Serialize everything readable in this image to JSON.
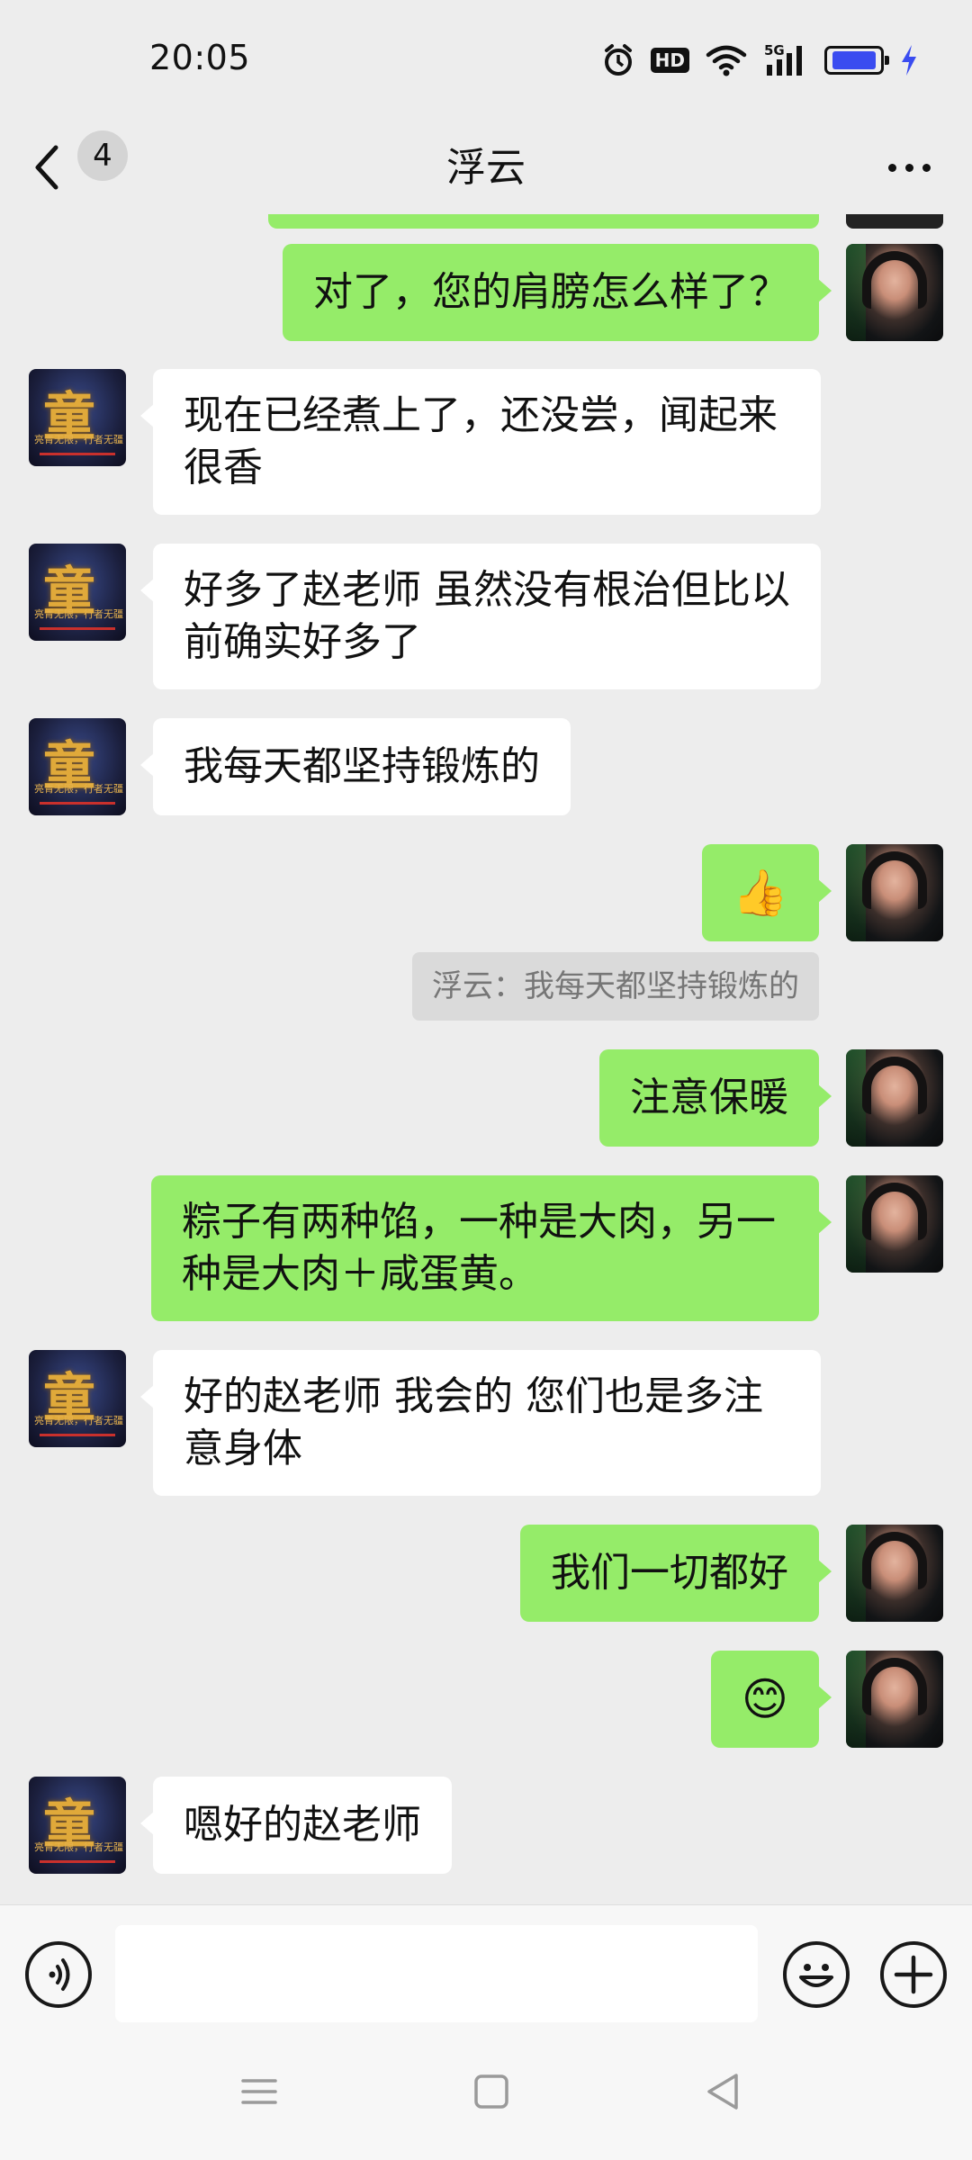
{
  "status_bar": {
    "time": "20:05",
    "icons": [
      "alarm-icon",
      "hd-icon",
      "wifi-icon",
      "5g-signal-icon",
      "battery-icon",
      "charging-icon"
    ],
    "hd_label": "HD",
    "network_label": "5G",
    "battery_level": 0.9,
    "battery_color": "#3a4cf0"
  },
  "nav": {
    "title": "浮云",
    "unread_count": "4"
  },
  "messages": [
    {
      "side": "out",
      "text": "对了，您的肩膀怎么样了？"
    },
    {
      "side": "in",
      "text": "现在已经煮上了，还没尝，闻起来很香"
    },
    {
      "side": "in",
      "text": "好多了赵老师  虽然没有根治但比以前确实好多了"
    },
    {
      "side": "in",
      "text": "我每天都坚持锻炼的"
    },
    {
      "side": "out",
      "text": "👍"
    },
    {
      "side": "quote",
      "text": "浮云：我每天都坚持锻炼的"
    },
    {
      "side": "out",
      "text": "注意保暖"
    },
    {
      "side": "out",
      "text": "粽子有两种馅，一种是大肉，另一种是大肉＋咸蛋黄。"
    },
    {
      "side": "in",
      "text": "好的赵老师  我会的  您们也是多注意身体"
    },
    {
      "side": "out",
      "text": "我们一切都好"
    },
    {
      "side": "out",
      "text": "😊"
    },
    {
      "side": "in",
      "text": "嗯好的赵老师"
    }
  ],
  "contact_avatar": {
    "glyph": "童",
    "subtitle": "亮青无限，行者无疆"
  },
  "input": {
    "value": ""
  },
  "colors": {
    "background": "#ededed",
    "outgoing_bubble": "#95ec69",
    "incoming_bubble": "#ffffff",
    "quote_bg": "#dadada"
  }
}
